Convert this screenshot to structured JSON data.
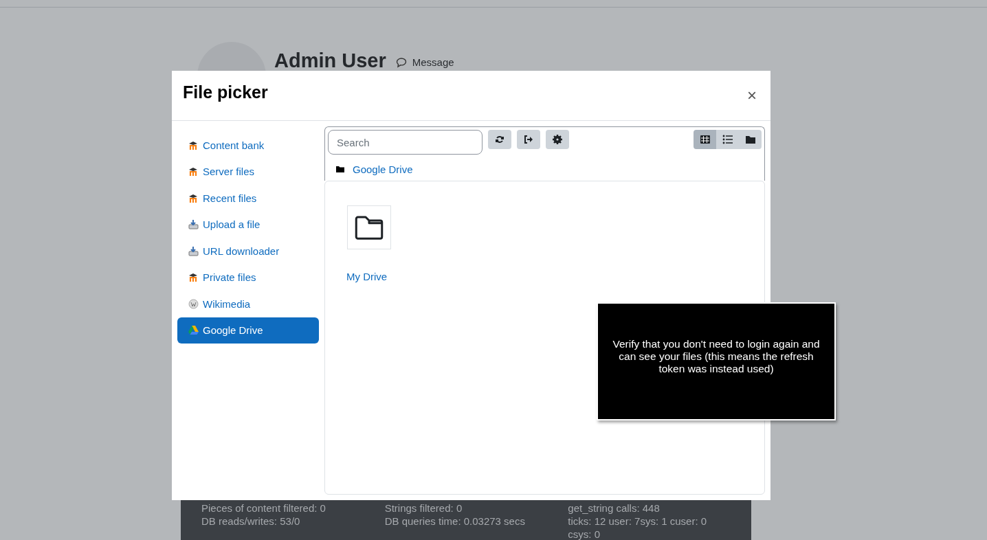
{
  "page": {
    "profile": {
      "name": "Admin User",
      "message_link": "Message"
    },
    "footer": {
      "columns": [
        [
          "Pieces of content filtered: 0",
          "DB reads/writes: 53/0"
        ],
        [
          "Strings filtered: 0",
          "DB queries time: 0.03273 secs"
        ],
        [
          "get_string calls: 448",
          "ticks: 12 user: 7sys: 1 cuser: 0",
          "csys: 0"
        ]
      ]
    }
  },
  "dialog": {
    "title": "File picker",
    "close": "×",
    "repositories": [
      {
        "label": "Content bank",
        "kind": "moodle",
        "selected": false
      },
      {
        "label": "Server files",
        "kind": "moodle",
        "selected": false
      },
      {
        "label": "Recent files",
        "kind": "moodle",
        "selected": false
      },
      {
        "label": "Upload a file",
        "kind": "upload",
        "selected": false
      },
      {
        "label": "URL downloader",
        "kind": "upload",
        "selected": false
      },
      {
        "label": "Private files",
        "kind": "moodle",
        "selected": false
      },
      {
        "label": "Wikimedia",
        "kind": "wikimedia",
        "selected": false
      },
      {
        "label": "Google Drive",
        "kind": "drive",
        "selected": true
      }
    ],
    "search": {
      "placeholder": "Search"
    },
    "view_modes": [
      {
        "kind": "icons",
        "selected": true
      },
      {
        "kind": "list",
        "selected": false
      },
      {
        "kind": "tree",
        "selected": false
      }
    ],
    "breadcrumb": [
      {
        "label": "Google Drive"
      }
    ],
    "files": [
      {
        "label": "My Drive",
        "kind": "folder"
      }
    ]
  },
  "tooltip": {
    "text": "Verify that you don't need to login again and can see your files (this means the refresh token was instead used)"
  }
}
